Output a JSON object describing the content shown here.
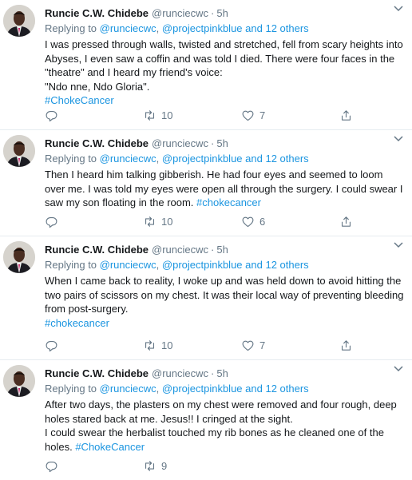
{
  "tweets": [
    {
      "name": "Runcie C.W. Chidebe",
      "handle": "@runciecwc",
      "dot": "·",
      "time": "5h",
      "replying_prefix": "Replying to ",
      "mention1": "@runciecwc",
      "separator": ", ",
      "mention2": "@projectpinkblue",
      "others": "and 12 others",
      "lines": [
        "I was pressed through walls, twisted and stretched, fell from scary heights into Abyses, I even saw a coffin and was told I died. There were four faces in the \"theatre\" and I heard my friend's voice:",
        "\"Ndo nne, Ndo Gloria\"."
      ],
      "hashtag_line": "#ChokeCancer",
      "retweets": "10",
      "likes": "7"
    },
    {
      "name": "Runcie C.W. Chidebe",
      "handle": "@runciecwc",
      "dot": "·",
      "time": "5h",
      "replying_prefix": "Replying to ",
      "mention1": "@runciecwc",
      "separator": ", ",
      "mention2": "@projectpinkblue",
      "others": "and 12 others",
      "text": "Then I heard him talking gibberish. He had four eyes and seemed to loom over me. I was told my eyes were open all through the surgery. I could swear I saw my son floating in the room.",
      "hashtag": "#chokecancer",
      "retweets": "10",
      "likes": "6"
    },
    {
      "name": "Runcie C.W. Chidebe",
      "handle": "@runciecwc",
      "dot": "·",
      "time": "5h",
      "replying_prefix": "Replying to ",
      "mention1": "@runciecwc",
      "separator": ", ",
      "mention2": "@projectpinkblue",
      "others": "and 12 others",
      "text": "When I came back to reality, I woke up and was held down to avoid hitting the two pairs of scissors on my chest. It was their local way of preventing bleeding from post-surgery.",
      "hashtag_line": "#chokecancer",
      "retweets": "10",
      "likes": "7"
    },
    {
      "name": "Runcie C.W. Chidebe",
      "handle": "@runciecwc",
      "dot": "·",
      "time": "5h",
      "replying_prefix": "Replying to ",
      "mention1": "@runciecwc",
      "separator": ", ",
      "mention2": "@projectpinkblue",
      "others": "and 12 others",
      "line1": "After two days, the plasters on my chest were removed and four rough, deep holes stared back at me. Jesus!! I cringed at the sight.",
      "line2": "I could swear the herbalist touched my rib bones as he cleaned one of the holes.",
      "hashtag": "#ChokeCancer",
      "retweets": "9",
      "likes": ""
    }
  ],
  "icons": {
    "reply": "reply-icon",
    "retweet": "retweet-icon",
    "like": "like-icon",
    "share": "share-icon",
    "caret": "chevron-down-icon"
  },
  "colors": {
    "link": "#1b95e0",
    "muted": "#657786",
    "text": "#14171a",
    "divider": "#e6ecf0"
  }
}
